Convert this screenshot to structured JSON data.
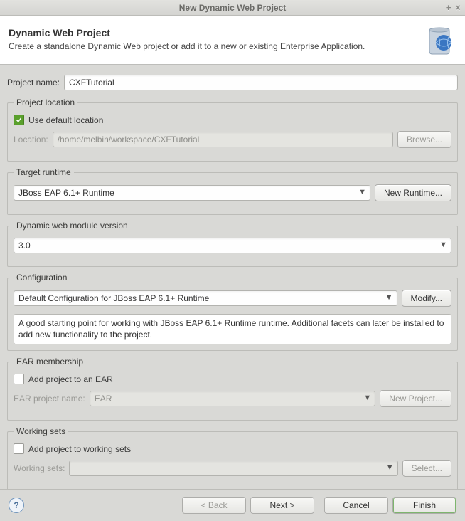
{
  "window": {
    "title": "New Dynamic Web Project"
  },
  "banner": {
    "heading": "Dynamic Web Project",
    "description": "Create a standalone Dynamic Web project or add it to a new or existing Enterprise Application."
  },
  "project_name": {
    "label": "Project name:",
    "value": "CXFTutorial"
  },
  "project_location": {
    "legend": "Project location",
    "use_default_label": "Use default location",
    "use_default_checked": true,
    "location_label": "Location:",
    "location_value": "/home/melbin/workspace/CXFTutorial",
    "browse_label": "Browse..."
  },
  "target_runtime": {
    "legend": "Target runtime",
    "value": "JBoss EAP 6.1+ Runtime",
    "new_runtime_label": "New Runtime..."
  },
  "web_module": {
    "legend": "Dynamic web module version",
    "value": "3.0"
  },
  "configuration": {
    "legend": "Configuration",
    "value": "Default Configuration for JBoss EAP 6.1+ Runtime",
    "modify_label": "Modify...",
    "description": "A good starting point for working with JBoss EAP 6.1+ Runtime runtime. Additional facets can later be installed to add new functionality to the project."
  },
  "ear": {
    "legend": "EAR membership",
    "add_label": "Add project to an EAR",
    "project_name_label": "EAR project name:",
    "project_name_value": "EAR",
    "new_project_label": "New Project..."
  },
  "working_sets": {
    "legend": "Working sets",
    "add_label": "Add project to working sets",
    "label": "Working sets:",
    "select_label": "Select..."
  },
  "footer": {
    "back": "< Back",
    "next": "Next >",
    "cancel": "Cancel",
    "finish": "Finish"
  }
}
